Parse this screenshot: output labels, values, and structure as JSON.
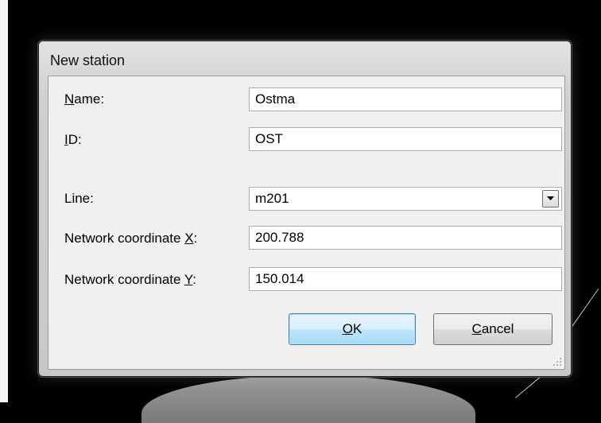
{
  "dialog": {
    "title": "New station"
  },
  "fields": {
    "name": {
      "label_mnemonic": "N",
      "label_rest": "ame:",
      "value": "Ostma"
    },
    "id": {
      "label_mnemonic": "I",
      "label_rest": "D:",
      "value": "OST"
    },
    "line": {
      "label": "Line:",
      "value": "m201"
    },
    "coord_x": {
      "label_prefix": "Network coordinate ",
      "label_mnemonic": "X",
      "label_suffix": ":",
      "value": "200.788"
    },
    "coord_y": {
      "label_prefix": "Network coordinate ",
      "label_mnemonic": "Y",
      "label_suffix": ":",
      "value": "150.014"
    }
  },
  "buttons": {
    "ok": {
      "mnemonic": "O",
      "rest": "K"
    },
    "cancel": {
      "mnemonic": "C",
      "rest": "ancel"
    }
  },
  "icons": {
    "dropdown": "chevron-down-icon",
    "grip": "resize-grip-icon"
  },
  "colors": {
    "focus_border": "#3c7fb1",
    "focus_fill": "#bee6fd",
    "dialog_bg": "#f0f0f0",
    "desktop_bg": "#000000"
  }
}
